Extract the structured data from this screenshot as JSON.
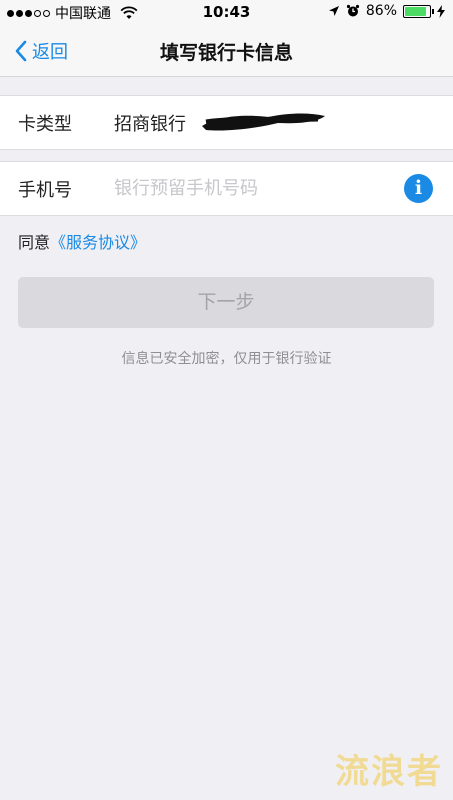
{
  "status_bar": {
    "carrier": "中国联通",
    "time": "10:43",
    "battery_percent": "86%",
    "battery_level": 0.86,
    "signal_bars_filled": 3,
    "signal_bars_total": 5
  },
  "nav": {
    "back_label": "返回",
    "title": "填写银行卡信息"
  },
  "form": {
    "card_type_label": "卡类型",
    "card_type_value": "招商银行",
    "phone_label": "手机号",
    "phone_value": "",
    "phone_placeholder": "银行预留手机号码",
    "info_icon": "i"
  },
  "agreement": {
    "prefix": "同意",
    "link": "《服务协议》"
  },
  "next_button": "下一步",
  "security_hint": "信息已安全加密，仅用于银行验证",
  "watermark": "流浪者",
  "colors": {
    "accent": "#1a8ae5",
    "background": "#efeff4",
    "battery": "#4cd964",
    "button_disabled": "#dadade"
  },
  "icons": [
    "wifi-icon",
    "location-arrow-icon",
    "alarm-clock-icon",
    "battery-icon",
    "charging-icon",
    "chevron-left-icon",
    "info-icon"
  ]
}
